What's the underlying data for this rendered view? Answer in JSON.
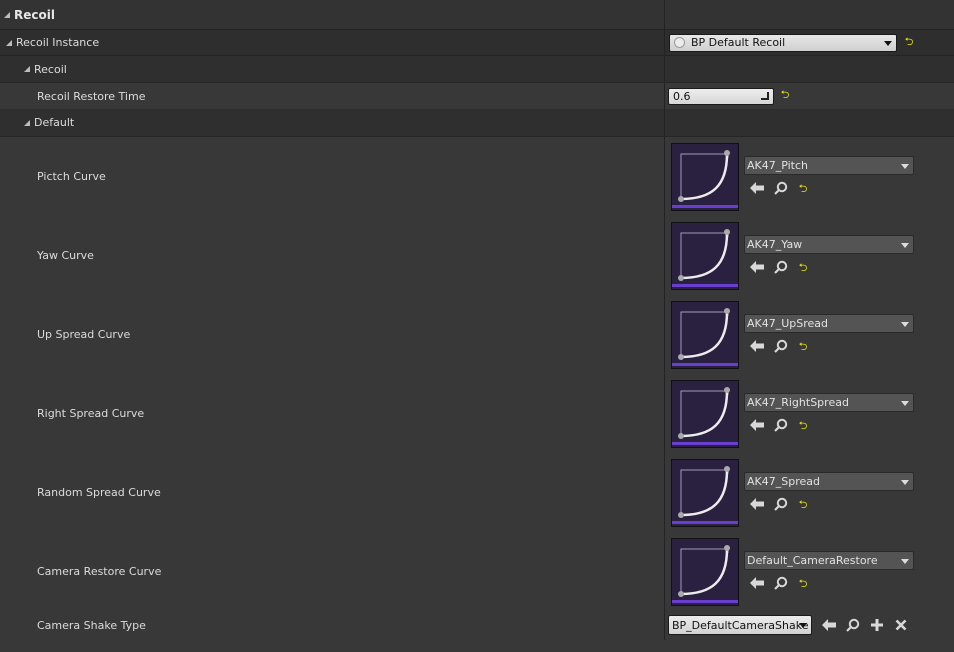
{
  "category": {
    "title": "Recoil"
  },
  "recoil_instance": {
    "label": "Recoil Instance",
    "value": "BP Default Recoil"
  },
  "recoil_group": {
    "label": "Recoil"
  },
  "restore_time": {
    "label": "Recoil Restore Time",
    "value": "0.6"
  },
  "default_group": {
    "label": "Default"
  },
  "curves": [
    {
      "label": "Pictch Curve",
      "asset": "AK47_Pitch"
    },
    {
      "label": "Yaw Curve",
      "asset": "AK47_Yaw"
    },
    {
      "label": "Up Spread Curve",
      "asset": "AK47_UpSread"
    },
    {
      "label": "Right Spread Curve",
      "asset": "AK47_RightSpread"
    },
    {
      "label": "Random Spread Curve",
      "asset": "AK47_Spread"
    },
    {
      "label": "Camera Restore Curve",
      "asset": "Default_CameraRestore"
    }
  ],
  "camera_shake": {
    "label": "Camera Shake Type",
    "value": "BP_DefaultCameraShake"
  },
  "icons": {
    "reset": "reset-to-default-icon",
    "use_selected": "arrow-left-icon",
    "browse": "search-icon",
    "add": "plus-icon",
    "clear": "close-icon"
  },
  "colors": {
    "background": "#383838",
    "category_bg": "#2e2e2e",
    "thumb_bg": "#2a2040",
    "thumb_bar": "#6a3fd0",
    "reset_arrow": "#e8e000"
  }
}
